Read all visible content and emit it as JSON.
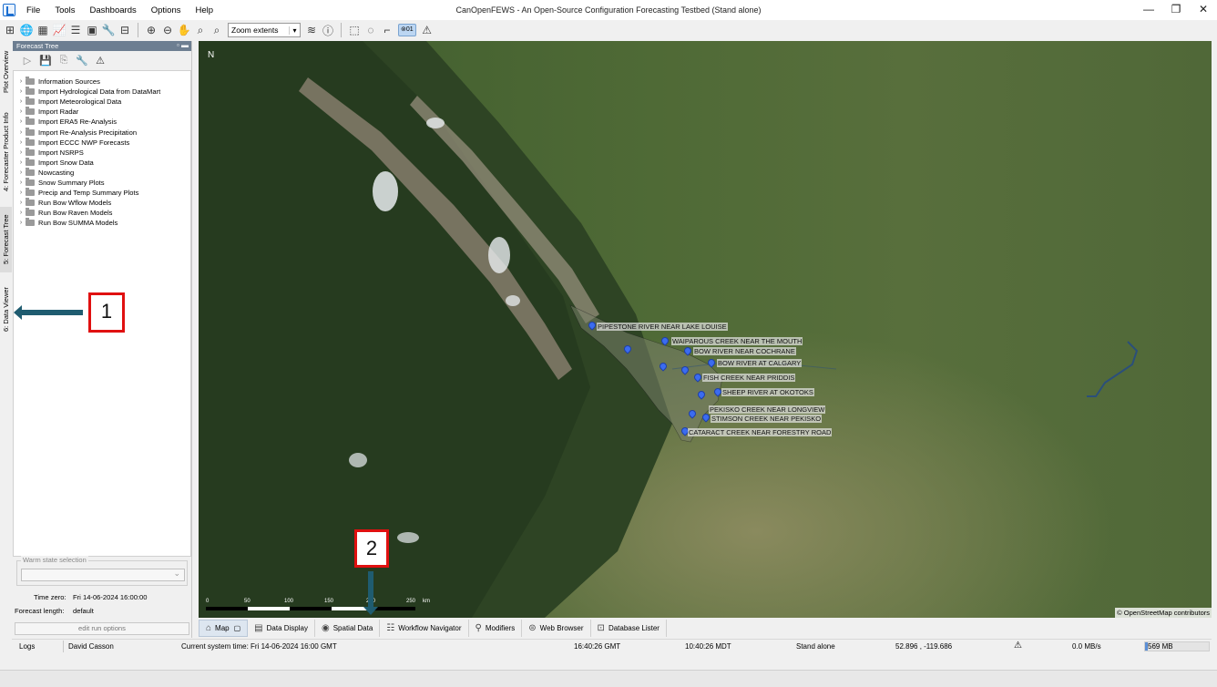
{
  "app": {
    "title": "CanOpenFEWS - An Open-Source Configuration Forecasting Testbed  (Stand alone)",
    "menu": [
      "File",
      "Tools",
      "Dashboards",
      "Options",
      "Help"
    ],
    "window_controls": [
      "—",
      "❐",
      "✕"
    ]
  },
  "toolbar": {
    "zoom_value": "Zoom extents",
    "badge": "⊚01"
  },
  "side_tabs": [
    "Plot Overview",
    "4: Forecaster Product Info",
    "5: Forecast Tree",
    "6: Data Viewer"
  ],
  "forecast_tree": {
    "title": "Forecast Tree",
    "items": [
      "Information Sources",
      "Import Hydrological Data from DataMart",
      "Import Meteorological Data",
      "Import Radar",
      "Import ERA5 Re-Analysis",
      "Import Re-Analysis Precipitation",
      "Import ECCC NWP Forecasts",
      "Import NSRPS",
      "Import Snow Data",
      "Nowcasting",
      "Snow Summary Plots",
      "Precip and Temp Summary Plots",
      "Run Bow Wflow Models",
      "Run Bow Raven Models",
      "Run Bow SUMMA Models"
    ]
  },
  "warm_state": {
    "legend": "Warm state selection",
    "time_zero_label": "Time zero:",
    "time_zero_value": "Fri 14-06-2024 16:00:00",
    "forecast_length_label": "Forecast length:",
    "forecast_length_value": "default",
    "run_options": "edit run options"
  },
  "map": {
    "north": "N",
    "attribution": "© OpenStreetMap contributors",
    "scale_labels": [
      "0",
      "50",
      "100",
      "150",
      "200",
      "250",
      "km"
    ],
    "gauges": [
      "PIPESTONE RIVER NEAR LAKE LOUISE",
      "WAIPAROUS CREEK NEAR THE MOUTH",
      "BOW RIVER NEAR COCHRANE",
      "BOW RIVER AT CALGARY",
      "FISH CREEK NEAR PRIDDIS",
      "SHEEP RIVER AT OKOTOKS",
      "PEKISKO CREEK NEAR LONGVIEW",
      "STIMSON CREEK NEAR PEKISKO",
      "CATARACT CREEK NEAR FORESTRY ROAD"
    ],
    "callouts": [
      "1",
      "2"
    ]
  },
  "bottom_tabs": [
    "Map",
    "Data Display",
    "Spatial Data",
    "Workflow Navigator",
    "Modifiers",
    "Web Browser",
    "Database Lister"
  ],
  "status": {
    "logs": "Logs",
    "user": "David Casson",
    "system_time": "Current system time: Fri 14-06-2024 16:00 GMT",
    "gmt": "16:40:26 GMT",
    "mdt": "10:40:26 MDT",
    "mode": "Stand alone",
    "coords": "52.896 , -119.686",
    "rate": "0.0 MB/s",
    "memory": "569 MB"
  },
  "colors": {
    "panel_header": "#6d7e91",
    "callout_border": "#e01010",
    "arrow": "#1f5c70",
    "gauge_pin": "#3b6cf0"
  }
}
